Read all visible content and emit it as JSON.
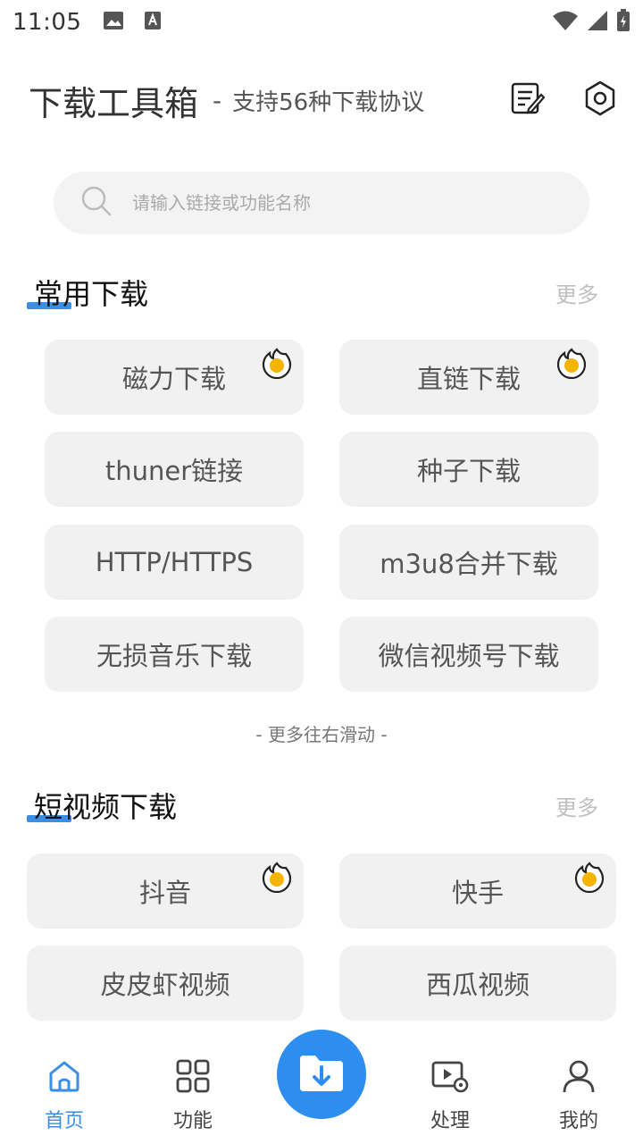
{
  "status_bar": {
    "time": "11:05"
  },
  "header": {
    "title": "下载工具箱",
    "separator": "-",
    "subtitle": "支持56种下载协议"
  },
  "search": {
    "placeholder": "请输入链接或功能名称"
  },
  "sections": [
    {
      "title": "常用下载",
      "more_label": "更多",
      "items": [
        {
          "label": "磁力下载",
          "hot": true
        },
        {
          "label": "直链下载",
          "hot": true
        },
        {
          "label": "thuner链接",
          "hot": false
        },
        {
          "label": "种子下载",
          "hot": false
        },
        {
          "label": "HTTP/HTTPS",
          "hot": false
        },
        {
          "label": "m3u8合并下载",
          "hot": false
        },
        {
          "label": "无损音乐下载",
          "hot": false
        },
        {
          "label": "微信视频号下载",
          "hot": false
        }
      ],
      "scroll_hint": "- 更多往右滑动 -"
    },
    {
      "title": "短视频下载",
      "more_label": "更多",
      "items": [
        {
          "label": "抖音",
          "hot": true
        },
        {
          "label": "快手",
          "hot": true
        },
        {
          "label": "皮皮虾视频",
          "hot": false
        },
        {
          "label": "西瓜视频",
          "hot": false
        }
      ]
    }
  ],
  "bottom_nav": {
    "items": [
      {
        "label": "首页",
        "icon": "home-icon",
        "active": true
      },
      {
        "label": "功能",
        "icon": "grid-icon",
        "active": false
      },
      {
        "label": "处理",
        "icon": "video-settings-icon",
        "active": false
      },
      {
        "label": "我的",
        "icon": "user-icon",
        "active": false
      }
    ],
    "center_icon": "download-folder-icon"
  },
  "colors": {
    "accent": "#2d8ef0",
    "chip_bg": "#f1f1f1",
    "hot_orange": "#f5a623"
  }
}
